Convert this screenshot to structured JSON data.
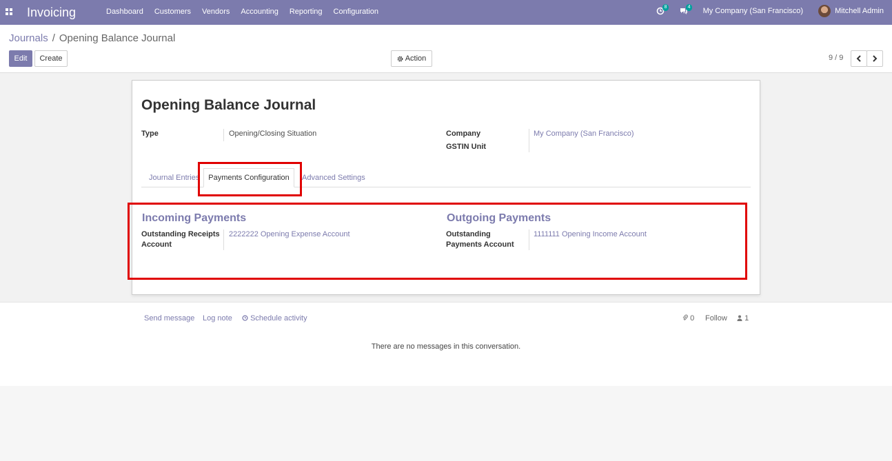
{
  "navbar": {
    "app_title": "Invoicing",
    "menu": [
      "Dashboard",
      "Customers",
      "Vendors",
      "Accounting",
      "Reporting",
      "Configuration"
    ],
    "activity_count": "8",
    "message_count": "4",
    "company": "My Company (San Francisco)",
    "user": "Mitchell Admin"
  },
  "control": {
    "breadcrumb_parent": "Journals",
    "breadcrumb_current": "Opening Balance Journal",
    "edit_label": "Edit",
    "create_label": "Create",
    "action_label": "Action",
    "pager": "9 / 9"
  },
  "form": {
    "title": "Opening Balance Journal",
    "type_label": "Type",
    "type_value": "Opening/Closing Situation",
    "company_label": "Company",
    "company_value": "My Company (San Francisco)",
    "gstin_label": "GSTIN Unit",
    "tabs": [
      "Journal Entries",
      "Payments Configuration",
      "Advanced Settings"
    ],
    "incoming": {
      "title": "Incoming Payments",
      "label_line1": "Outstanding Receipts",
      "label_line2": "Account",
      "value": "2222222 Opening Expense Account"
    },
    "outgoing": {
      "title": "Outgoing Payments",
      "label_line1": "Outstanding",
      "label_line2": "Payments Account",
      "value": "1111111 Opening Income Account"
    }
  },
  "chatter": {
    "send_message": "Send message",
    "log_note": "Log note",
    "schedule_activity": "Schedule activity",
    "attachments": "0",
    "follow": "Follow",
    "followers": "1",
    "empty": "There are no messages in this conversation."
  },
  "colors": {
    "brand": "#7c7bad",
    "highlight": "#e00000",
    "badge": "#00a09d"
  }
}
